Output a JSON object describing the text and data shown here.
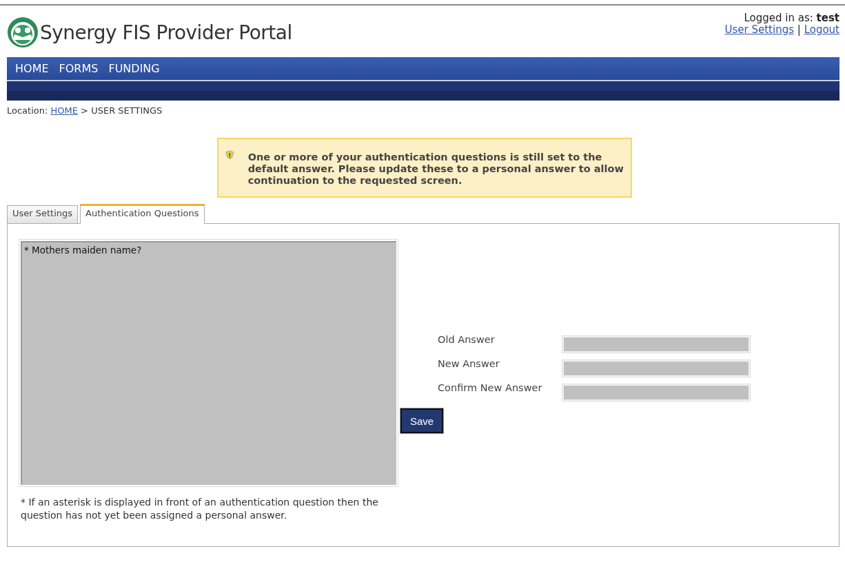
{
  "header": {
    "title": "Synergy FIS Provider Portal",
    "logged_in_label": "Logged in as:",
    "user": "test",
    "links": [
      "User Settings",
      "Logout"
    ],
    "separator": "|"
  },
  "nav": {
    "items": [
      "HOME",
      "FORMS",
      "FUNDING"
    ]
  },
  "breadcrumb": {
    "label": "Location:",
    "link": "HOME",
    "separator": ">",
    "current": "USER SETTINGS"
  },
  "alert": {
    "message": "One or more of your authentication questions is still set to the default answer. Please update these to a personal answer to allow continuation to the requested screen."
  },
  "tabs": [
    {
      "label": "User Settings",
      "selected": false
    },
    {
      "label": "Authentication Questions",
      "selected": true
    }
  ],
  "questions": {
    "items": [
      "* Mothers maiden name?"
    ],
    "footnote": "* If an asterisk is displayed in front of an authentication question then the question has not yet been assigned a personal answer."
  },
  "form": {
    "fields": [
      {
        "label": "Old Answer"
      },
      {
        "label": "New Answer"
      },
      {
        "label": "Confirm New Answer"
      }
    ],
    "button": "Save"
  }
}
